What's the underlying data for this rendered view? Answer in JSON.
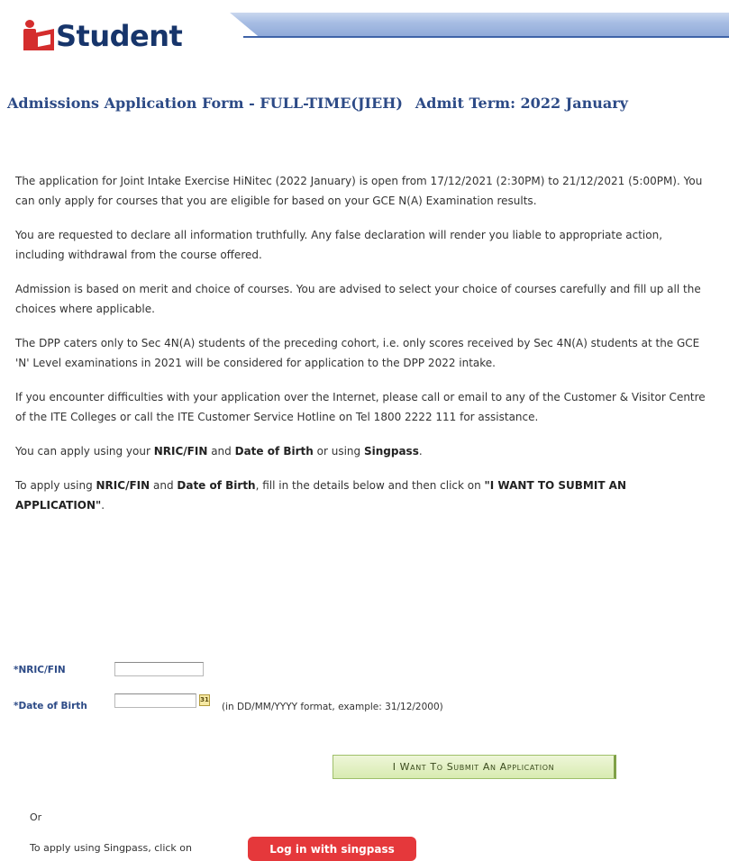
{
  "header": {
    "logo_text": "Student"
  },
  "title": {
    "main": "Admissions Application Form - FULL-TIME(JIEH)",
    "term": "Admit Term: 2022 January"
  },
  "paragraphs": {
    "p1": "The application for Joint Intake Exercise HiNitec (2022 January) is open from 17/12/2021 (2:30PM) to 21/12/2021 (5:00PM). You can only apply for courses that you are eligible for based on your GCE N(A) Examination results.",
    "p2": "You are requested to declare all information truthfully. Any false declaration will render you liable to appropriate action, including withdrawal from the course offered.",
    "p3": "Admission is based on merit and choice of courses. You are advised to select your choice of courses carefully and fill up all the choices where applicable.",
    "p4": "The DPP caters only to Sec 4N(A) students of the preceding cohort, i.e. only scores received by Sec 4N(A) students at the GCE 'N' Level examinations in 2021 will be considered for application to the DPP 2022 intake.",
    "p5": "If you encounter difficulties with your application over the Internet, please call or email to any of the Customer & Visitor Centre of the ITE Colleges or call the ITE Customer Service Hotline on Tel 1800 2222 111 for assistance.",
    "p6": {
      "a": "You can apply using your ",
      "b": "NRIC/FIN",
      "c": " and ",
      "d": "Date of Birth",
      "e": " or using ",
      "f": "Singpass",
      "g": "."
    },
    "p7": {
      "a": "To apply using ",
      "b": "NRIC/FIN",
      "c": " and ",
      "d": "Date of Birth",
      "e": ", fill in the details below and then click on ",
      "f": "\"I WANT TO SUBMIT AN APPLICATION\"",
      "g": "."
    }
  },
  "form": {
    "nric_label": "*NRIC/FIN",
    "nric_value": "",
    "dob_label": "*Date of Birth",
    "dob_value": "",
    "calendar_glyph": "31",
    "dob_hint": "(in DD/MM/YYYY format, example: 31/12/2000)",
    "submit_label": "I Want To Submit An Application"
  },
  "alt": {
    "or_text": "Or",
    "singpass_prompt": "To apply using Singpass, click on",
    "singpass_button": "Log in with singpass"
  },
  "colors": {
    "brand_red": "#d42d2d",
    "title_blue": "#2c4a86",
    "singpass_red": "#e5383b",
    "submit_green": "#d8ebb1"
  }
}
